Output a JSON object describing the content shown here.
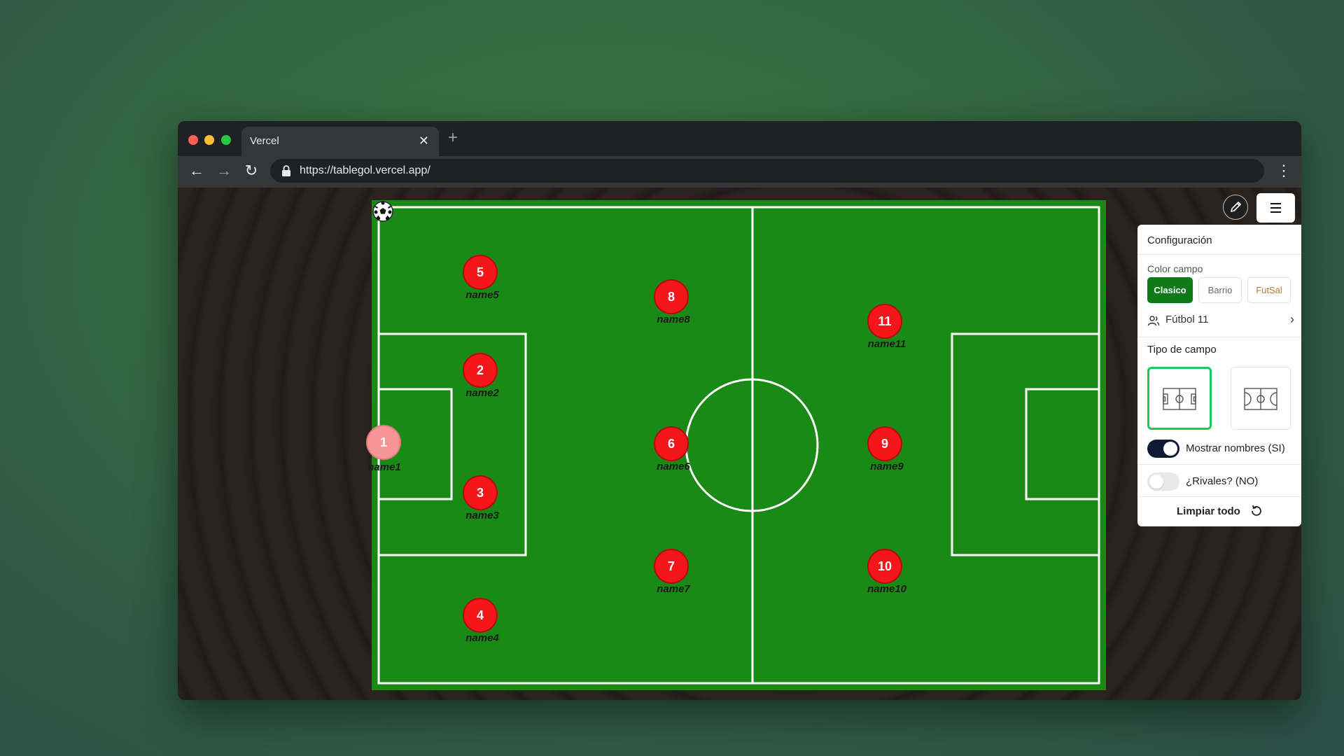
{
  "browser": {
    "tab_title": "Vercel",
    "tab_close": "✕",
    "new_tab": "+",
    "url": "https://tablegol.vercel.app/",
    "back": "←",
    "forward": "→",
    "reload": "↻",
    "menu": "⋮"
  },
  "field": {
    "color": "#1a8a16",
    "line_color": "#ffffff",
    "players": [
      {
        "number": "1",
        "name": "name1"
      },
      {
        "number": "2",
        "name": "name2"
      },
      {
        "number": "3",
        "name": "name3"
      },
      {
        "number": "4",
        "name": "name4"
      },
      {
        "number": "5",
        "name": "name5"
      },
      {
        "number": "6",
        "name": "name6"
      },
      {
        "number": "7",
        "name": "name7"
      },
      {
        "number": "8",
        "name": "name8"
      },
      {
        "number": "9",
        "name": "name9"
      },
      {
        "number": "10",
        "name": "name10"
      },
      {
        "number": "11",
        "name": "name11"
      }
    ]
  },
  "panel": {
    "title": "Configuración",
    "color_label": "Color campo",
    "color_options": [
      "Clasico",
      "Barrio",
      "FutSal"
    ],
    "selected_color": "Clasico",
    "mode": "Fútbol 11",
    "field_type_label": "Tipo de campo",
    "show_names": "Mostrar nombres (SI)",
    "show_names_on": true,
    "rivals": "¿Rivales? (NO)",
    "rivals_on": false,
    "clear_all": "Limpiar todo"
  },
  "colors": {
    "player": "#f4161a",
    "goalkeeper": "#f59595",
    "accent": "#0f7b18",
    "selected_border": "#22c55e"
  }
}
